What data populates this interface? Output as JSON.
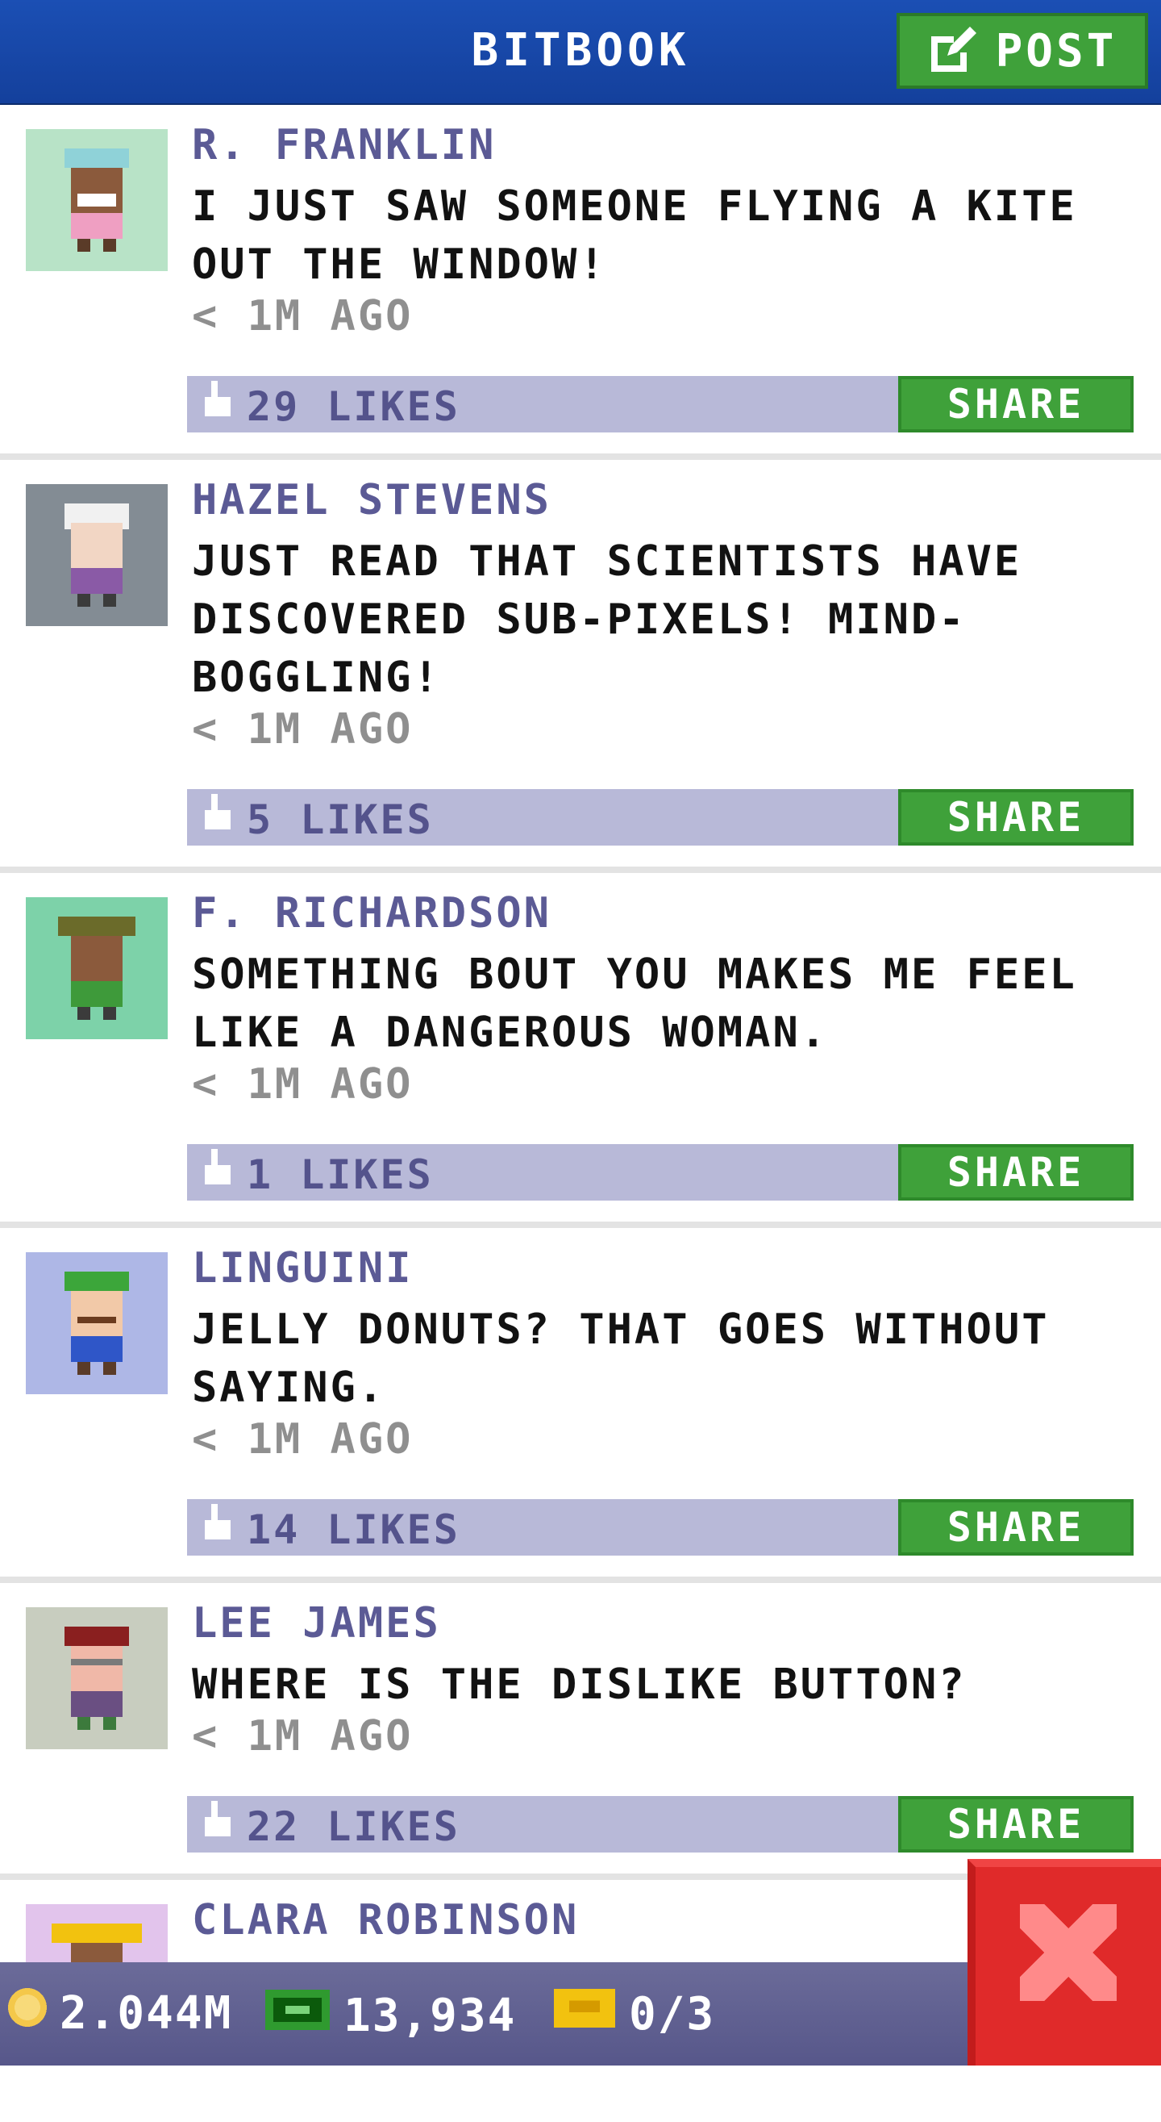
{
  "app": {
    "title": "BITBOOK",
    "post_label": "POST",
    "brand_color": "#1b4fb4",
    "accent_color": "#3fa13a"
  },
  "posts": [
    {
      "author": "R. FRANKLIN",
      "message": "I JUST SAW SOMEONE FLYING A KITE OUT THE WINDOW!",
      "time": "< 1M AGO",
      "likes": "29 LIKES",
      "share_label": "SHARE",
      "avatar_bg": "#b8e3c7",
      "avatar_icon": "bitizen-avatar-icon"
    },
    {
      "author": "HAZEL STEVENS",
      "message": "JUST READ THAT SCIENTISTS HAVE DISCOVERED SUB-PIXELS! MIND-BOGGLING!",
      "time": "< 1M AGO",
      "likes": "5 LIKES",
      "share_label": "SHARE",
      "avatar_bg": "#838c94",
      "avatar_icon": "bitizen-avatar-icon"
    },
    {
      "author": "F. RICHARDSON",
      "message": "SOMETHING BOUT YOU MAKES ME FEEL LIKE A DANGEROUS WOMAN.",
      "time": "< 1M AGO",
      "likes": "1 LIKES",
      "share_label": "SHARE",
      "avatar_bg": "#7dd2a9",
      "avatar_icon": "bitizen-avatar-icon"
    },
    {
      "author": "LINGUINI",
      "message": "JELLY DONUTS? THAT GOES WITHOUT SAYING.",
      "time": "< 1M AGO",
      "likes": "14 LIKES",
      "share_label": "SHARE",
      "avatar_bg": "#aeb7e6",
      "avatar_icon": "bitizen-avatar-icon"
    },
    {
      "author": "LEE JAMES",
      "message": "WHERE IS THE DISLIKE BUTTON?",
      "time": "< 1M AGO",
      "likes": "22 LIKES",
      "share_label": "SHARE",
      "avatar_bg": "#c8cdbf",
      "avatar_icon": "bitizen-avatar-icon"
    },
    {
      "author": "CLARA ROBINSON",
      "message": "",
      "time": "",
      "likes": "",
      "share_label": "",
      "avatar_bg": "#e2c4ec",
      "avatar_icon": "bitizen-avatar-icon"
    }
  ],
  "status": {
    "coins": "2.044M",
    "bux": "13,934",
    "tickets": "0/3",
    "coin_icon": "coin-icon",
    "bux_icon": "bux-icon",
    "ticket_icon": "ticket-icon",
    "close_icon": "close-icon"
  }
}
